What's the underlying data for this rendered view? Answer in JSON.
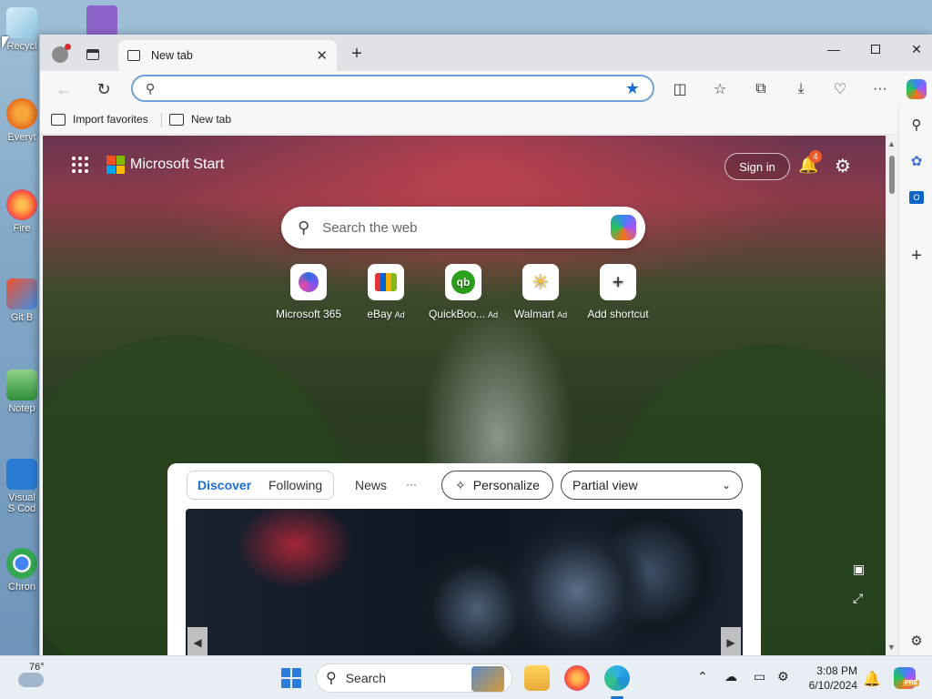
{
  "desktop": {
    "icons": [
      {
        "label": "Recycl"
      },
      {
        "label": "Everyt"
      },
      {
        "label": "Fire"
      },
      {
        "label": "Git B"
      },
      {
        "label": "Notep"
      },
      {
        "label": "Visual S Cod"
      },
      {
        "label": "Chron"
      }
    ]
  },
  "browser": {
    "tab_title": "New tab",
    "address_value": "",
    "favorites": {
      "import_label": "Import favorites",
      "newtab_label": "New tab"
    }
  },
  "page": {
    "brand": "Microsoft Start",
    "sign_in": "Sign in",
    "notification_count": "4",
    "search_placeholder": "Search the web",
    "shortcuts": [
      {
        "label": "Microsoft 365",
        "ad": ""
      },
      {
        "label": "eBay",
        "ad": "Ad"
      },
      {
        "label": "QuickBoo...",
        "ad": "Ad"
      },
      {
        "label": "Walmart",
        "ad": "Ad"
      },
      {
        "label": "Add shortcut",
        "ad": ""
      }
    ],
    "feed": {
      "tabs": [
        "Discover",
        "Following",
        "News"
      ],
      "more": "···",
      "personalize": "Personalize",
      "view_select": "Partial view"
    }
  },
  "taskbar": {
    "temperature": "76°",
    "search_label": "Search",
    "time": "3:08 PM",
    "date": "6/10/2024",
    "copilot_badge": "PRE"
  },
  "colors": {
    "accent": "#1a6fd1",
    "badge": "#e85d2a"
  }
}
